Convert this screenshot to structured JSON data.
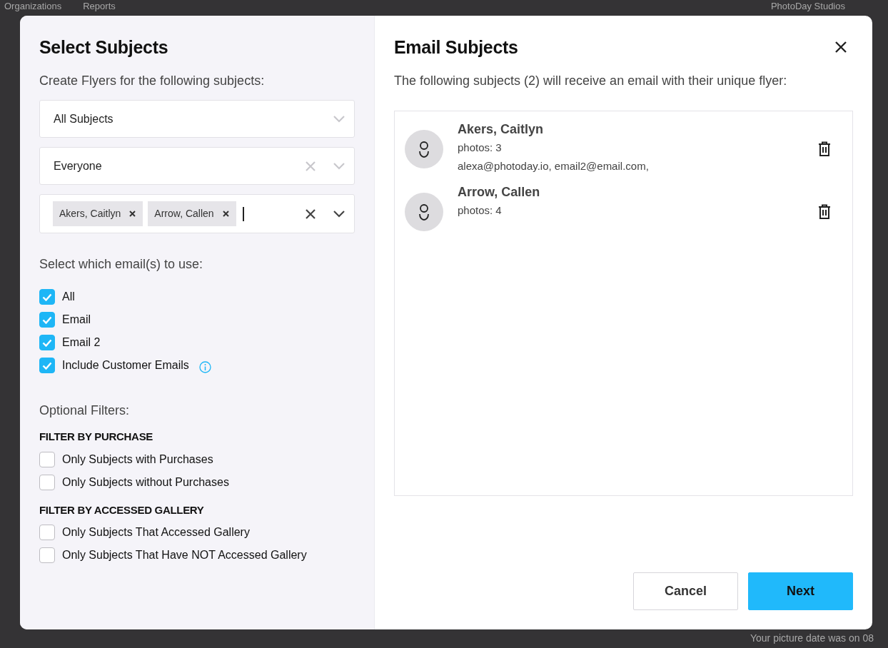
{
  "backdrop": {
    "nav": [
      "Organizations",
      "Reports"
    ],
    "studio": "PhotoDay Studios",
    "note": "Your picture date was on 08"
  },
  "left": {
    "title": "Select Subjects",
    "subtitle": "Create Flyers for the following subjects:",
    "selects": [
      {
        "kind": "single",
        "value": "All Subjects",
        "clearable": false,
        "focused": false
      },
      {
        "kind": "single",
        "value": "Everyone",
        "clearable": true,
        "focused": false
      },
      {
        "kind": "multi",
        "tags": [
          "Akers, Caitlyn",
          "Arrow, Callen"
        ],
        "clearable": true,
        "focused": true
      }
    ],
    "email_label": "Select which email(s) to use:",
    "email_options": [
      {
        "label": "All",
        "checked": true
      },
      {
        "label": "Email",
        "checked": true
      },
      {
        "label": "Email 2",
        "checked": true
      },
      {
        "label": "Include Customer Emails",
        "checked": true,
        "info": true
      }
    ],
    "filters_label": "Optional Filters:",
    "filter_groups": [
      {
        "heading": "FILTER BY PURCHASE",
        "options": [
          {
            "label": "Only Subjects with Purchases",
            "checked": false
          },
          {
            "label": "Only Subjects without Purchases",
            "checked": false
          }
        ]
      },
      {
        "heading": "FILTER BY ACCESSED GALLERY",
        "options": [
          {
            "label": "Only Subjects That Accessed Gallery",
            "checked": false
          },
          {
            "label": "Only Subjects That Have NOT Accessed Gallery",
            "checked": false
          }
        ]
      }
    ]
  },
  "right": {
    "title": "Email Subjects",
    "description": "The following subjects (2) will receive an email with their unique flyer:",
    "subjects": [
      {
        "name": "Akers, Caitlyn",
        "photos": "photos: 3",
        "emails": "alexa@photoday.io, email2@email.com,"
      },
      {
        "name": "Arrow, Callen",
        "photos": "photos: 4"
      }
    ],
    "buttons": [
      {
        "label": "Cancel",
        "kind": "secondary"
      },
      {
        "label": "Next",
        "kind": "primary"
      }
    ]
  }
}
